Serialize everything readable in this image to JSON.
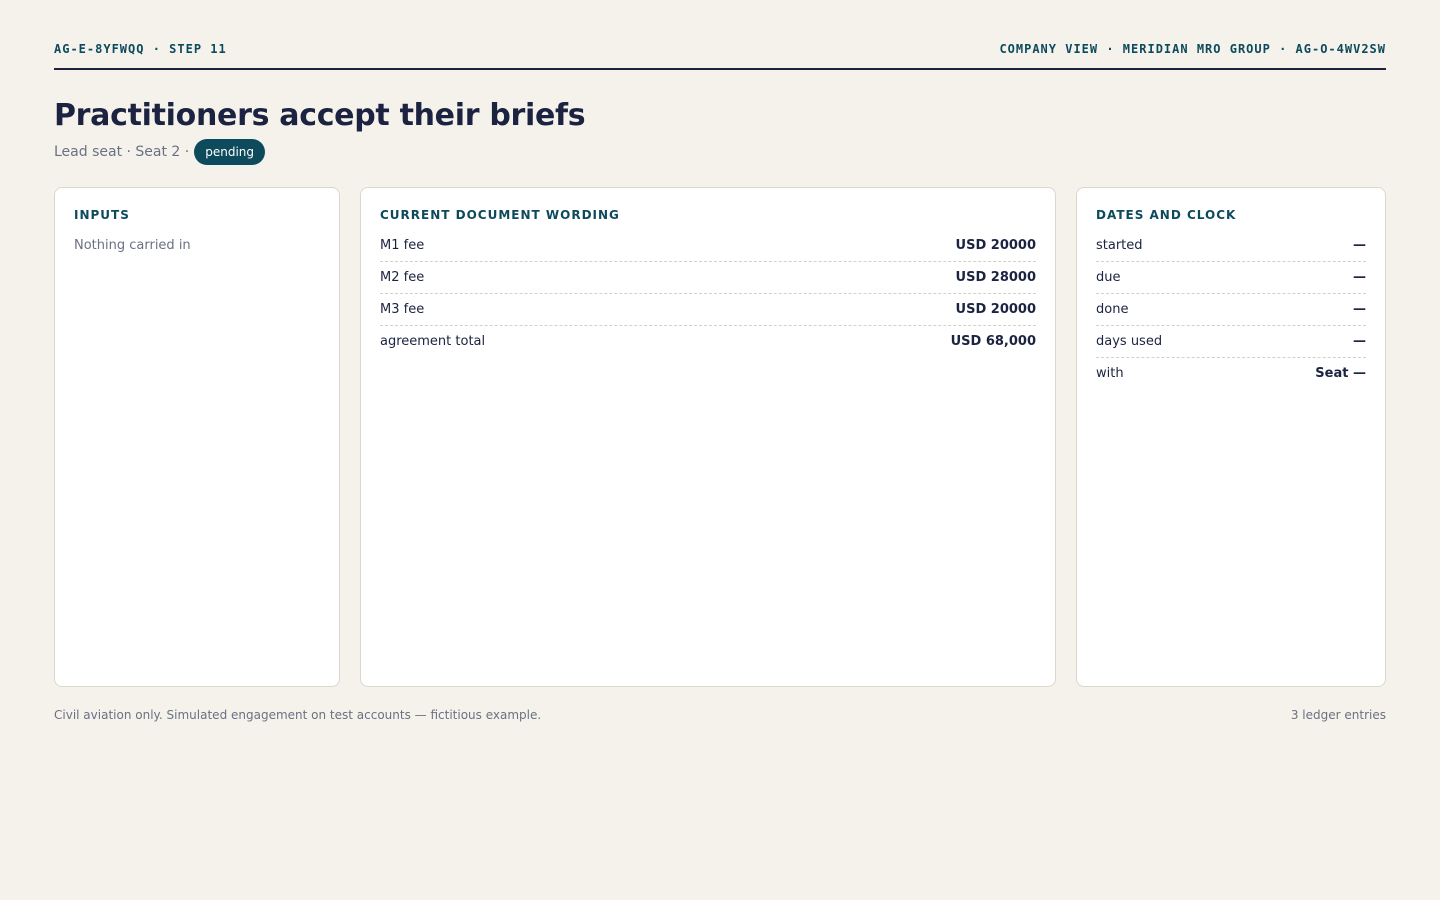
{
  "header": {
    "left": "AG-E-8YFWQQ · STEP 11",
    "right": "COMPANY VIEW · MERIDIAN MRO GROUP · AG-O-4WV2SW"
  },
  "title": "Practitioners accept their briefs",
  "subtitle": {
    "text": "Lead seat · Seat 2 ·",
    "status": "pending"
  },
  "inputs": {
    "title": "INPUTS",
    "empty": "Nothing carried in"
  },
  "document": {
    "title": "CURRENT DOCUMENT WORDING",
    "rows": [
      {
        "label": "M1 fee",
        "value": "USD 20000"
      },
      {
        "label": "M2 fee",
        "value": "USD 28000"
      },
      {
        "label": "M3 fee",
        "value": "USD 20000"
      },
      {
        "label": "agreement total",
        "value": "USD 68,000"
      }
    ]
  },
  "dates": {
    "title": "DATES AND CLOCK",
    "rows": [
      {
        "label": "started",
        "value": "—"
      },
      {
        "label": "due",
        "value": "—"
      },
      {
        "label": "done",
        "value": "—"
      },
      {
        "label": "days used",
        "value": "—"
      },
      {
        "label": "with",
        "value": "Seat —"
      }
    ]
  },
  "footer": {
    "note": "Civil aviation only. Simulated engagement on test accounts — fictitious example.",
    "count": "3 ledger entries"
  },
  "colors": {
    "background": "#f5f2ec",
    "accent": "#0d4a5c",
    "ink": "#1b2340",
    "muted": "#6b7183"
  }
}
